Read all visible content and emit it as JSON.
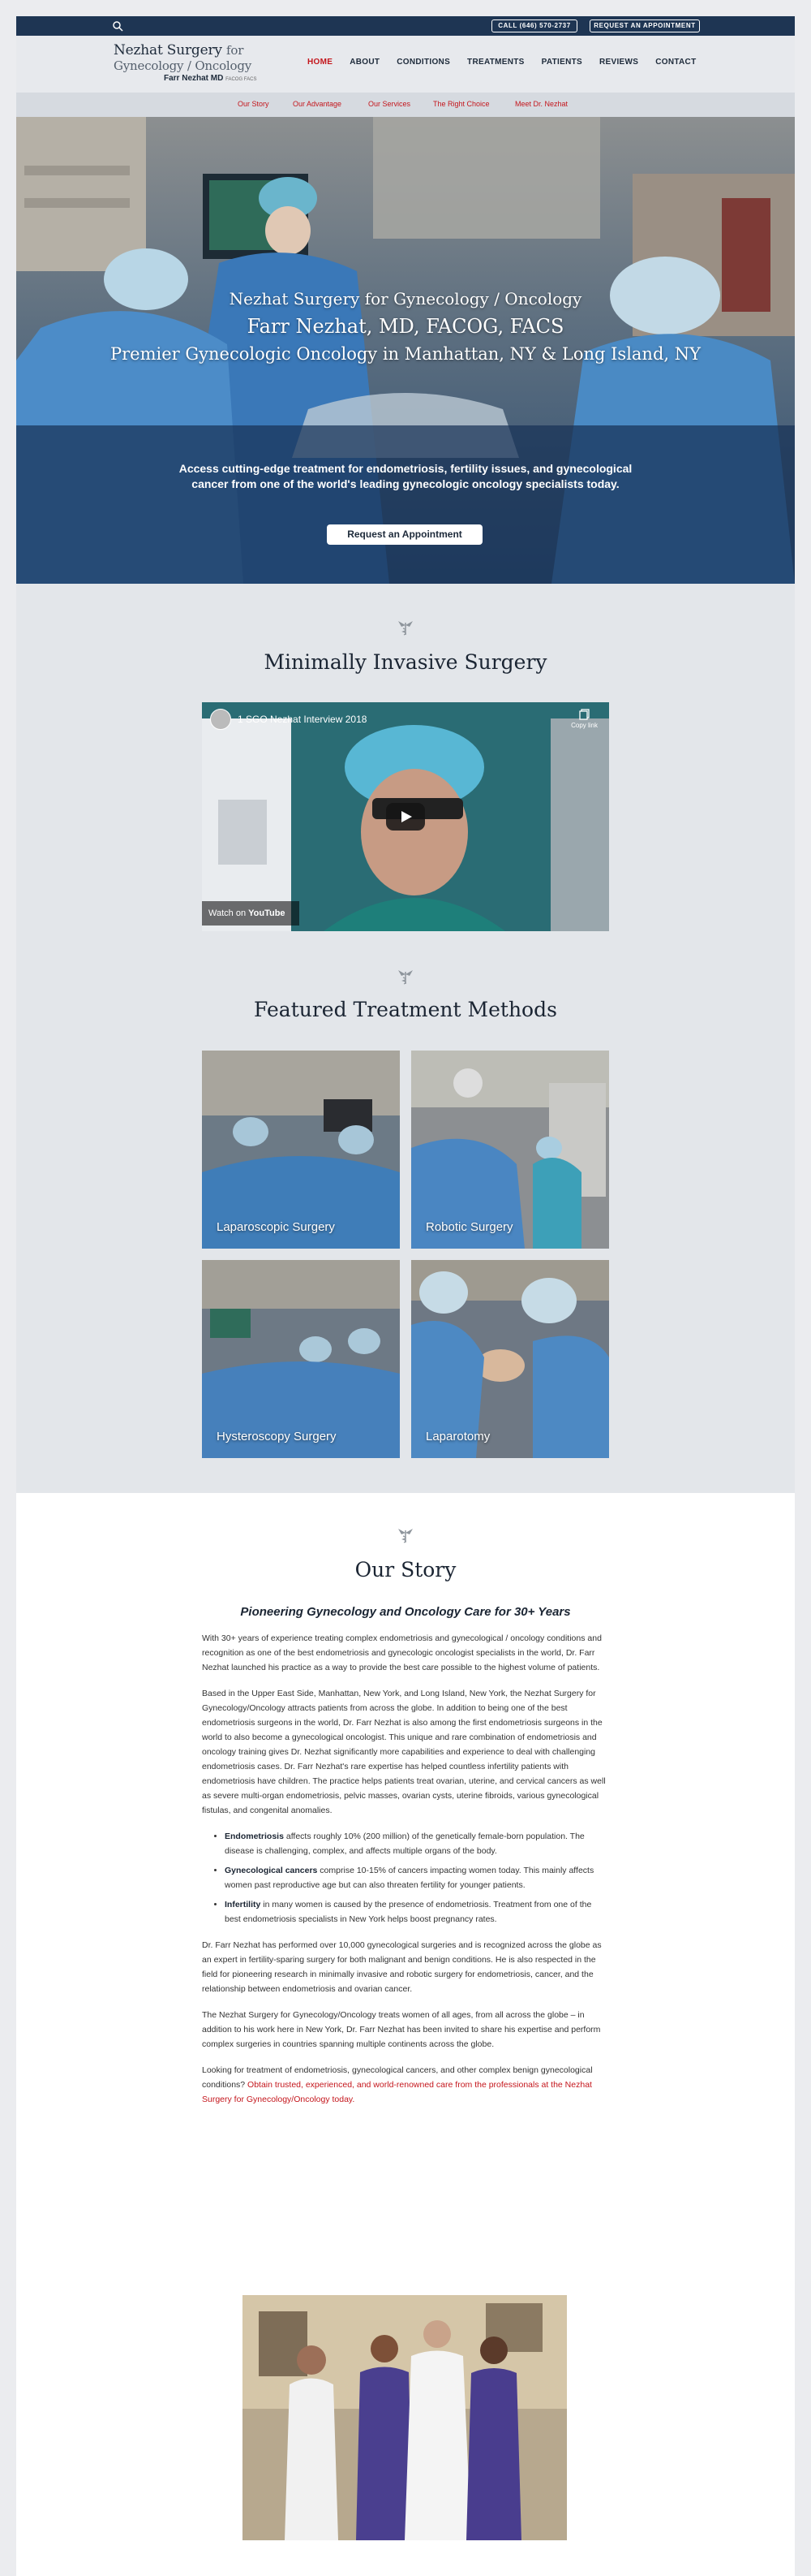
{
  "topbar": {
    "call_label": "CALL (646) 570-2737",
    "appt_label": "REQUEST AN APPOINTMENT",
    "search_icon": "search-icon"
  },
  "logo": {
    "line1_main": "Nezhat Surgery",
    "line1_thin": "for",
    "line2": "Gynecology / Oncology",
    "line3": "Farr Nezhat MD",
    "line3_small": "FACOG FACS"
  },
  "nav": {
    "items": [
      "HOME",
      "ABOUT",
      "CONDITIONS",
      "TREATMENTS",
      "PATIENTS",
      "REVIEWS",
      "CONTACT"
    ],
    "active": "HOME"
  },
  "subnav": {
    "items": [
      "Our Story",
      "Our Advantage",
      "Our Services",
      "The Right Choice",
      "Meet Dr. Nezhat"
    ]
  },
  "hero": {
    "title1": "Nezhat Surgery for Gynecology / Oncology",
    "title2": "Farr Nezhat, MD, FACOG, FACS",
    "title3": "Premier Gynecologic Oncology in Manhattan, NY & Long Island, NY",
    "intro": "Access cutting-edge treatment for endometriosis, fertility issues, and gynecological cancer from one of the world's leading gynecologic oncology specialists today.",
    "cta": "Request an Appointment"
  },
  "video_section": {
    "heading": "Minimally Invasive Surgery",
    "video_title": "1 SGO Nezhat Interview 2018",
    "copy_link": "Copy link",
    "watch_on": "Watch on",
    "youtube": "YouTube"
  },
  "treatments": {
    "heading": "Featured Treatment Methods",
    "items": [
      {
        "label": "Laparoscopic Surgery"
      },
      {
        "label": "Robotic Surgery"
      },
      {
        "label": "Hysteroscopy Surgery"
      },
      {
        "label": "Laparotomy"
      }
    ]
  },
  "story": {
    "heading": "Our Story",
    "subheading": "Pioneering Gynecology and Oncology Care for 30+ Years",
    "p1": "With 30+ years of experience treating complex endometriosis and gynecological / oncology conditions and recognition as one of the best endometriosis and gynecologic oncologist specialists in the world, Dr. Farr Nezhat launched his practice as a way to provide the best care possible to the highest volume of patients.",
    "p2": "Based in the Upper East Side, Manhattan, New York, and Long Island, New York, the Nezhat Surgery for Gynecology/Oncology attracts patients from across the globe. In addition to being one of the best endometriosis surgeons in the world, Dr. Farr Nezhat is also among the first endometriosis surgeons in the world to also become a gynecological oncologist. This unique and rare combination of endometriosis and oncology training gives Dr. Nezhat significantly more capabilities and experience to deal with challenging endometriosis cases. Dr. Farr Nezhat's rare expertise has helped countless infertility patients with endometriosis have children. The practice helps patients treat ovarian, uterine, and cervical cancers as well as severe multi-organ endometriosis, pelvic masses, ovarian cysts, uterine fibroids, various gynecological fistulas, and congenital anomalies.",
    "bullets": [
      {
        "bold": "Endometriosis",
        "text": " affects roughly 10% (200 million) of the genetically female-born population. The disease is challenging, complex, and affects multiple organs of the body."
      },
      {
        "bold": "Gynecological cancers",
        "text": " comprise 10-15% of cancers impacting women today. This mainly affects women past reproductive age but can also threaten fertility for younger patients."
      },
      {
        "bold": "Infertility",
        "text": " in many women is caused by the presence of endometriosis. Treatment from one of the best endometriosis specialists in New York helps boost pregnancy rates."
      }
    ],
    "p3": "Dr. Farr Nezhat has performed over 10,000 gynecological surgeries and is recognized across the globe as an expert in fertility-sparing surgery for both malignant and benign conditions. He is also respected in the field for pioneering research in minimally invasive and robotic surgery for endometriosis, cancer, and the relationship between endometriosis and ovarian cancer.",
    "p4": "The Nezhat Surgery for Gynecology/Oncology treats women of all ages, from all across the globe – in addition to his work here in New York, Dr. Farr Nezhat has been invited to share his expertise and perform complex surgeries in countries spanning multiple continents across the globe.",
    "p5": "Looking for treatment of endometriosis, gynecological cancers, and other complex benign gynecological conditions? ",
    "p5_link": "Obtain trusted, experienced, and world-renowned care from the professionals at the Nezhat Surgery for Gynecology/Oncology today."
  },
  "colors": {
    "navy": "#1e3553",
    "accent_red": "#c4161c"
  }
}
